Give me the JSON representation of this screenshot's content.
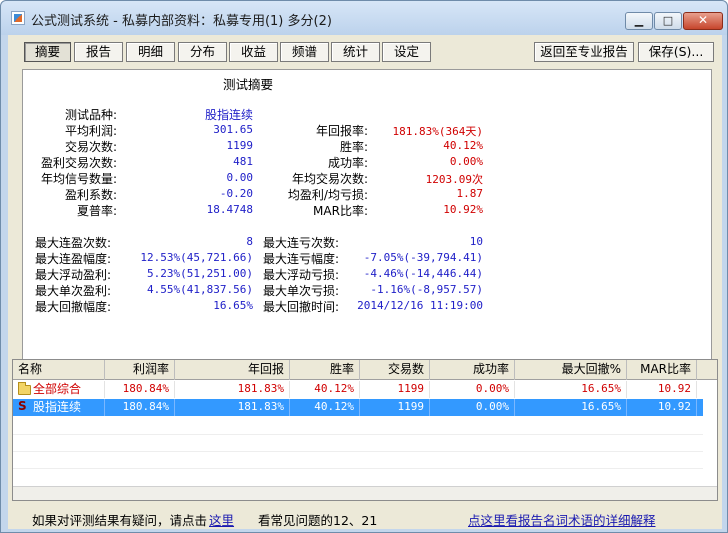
{
  "window": {
    "title": "公式测试系统 - 私募内部资料：私募专用(1) 多分(2)",
    "minimize_glyph": "▁",
    "maximize_glyph": "□",
    "close_glyph": "✕"
  },
  "tabs": [
    "摘要",
    "报告",
    "明细",
    "分布",
    "收益",
    "频谱",
    "统计",
    "设定"
  ],
  "toolbar": {
    "back_label": "返回至专业报告",
    "save_label": "保存(S)..."
  },
  "summary": {
    "title": "测试摘要",
    "left": [
      {
        "label": "测试品种:",
        "value": "股指连续"
      },
      {
        "label": "平均利润:",
        "value": "301.65"
      },
      {
        "label": "交易次数:",
        "value": "1199"
      },
      {
        "label": "盈利交易次数:",
        "value": "481"
      },
      {
        "label": "年均信号数量:",
        "value": "0.00"
      },
      {
        "label": "盈利系数:",
        "value": "-0.20"
      },
      {
        "label": "夏普率:",
        "value": "18.4748"
      }
    ],
    "right": [
      {
        "label": "年回报率:",
        "value": "181.83%(364天)"
      },
      {
        "label": "胜率:",
        "value": "40.12%"
      },
      {
        "label": "成功率:",
        "value": "0.00%"
      },
      {
        "label": "年均交易次数:",
        "value": "1203.09次"
      },
      {
        "label": "均盈利/均亏损:",
        "value": "1.87"
      },
      {
        "label": "MAR比率:",
        "value": "10.92%"
      }
    ],
    "left2": [
      {
        "label": "最大连盈次数:",
        "value": "8"
      },
      {
        "label": "最大连盈幅度:",
        "value": "12.53%(45,721.66)"
      },
      {
        "label": "最大浮动盈利:",
        "value": "5.23%(51,251.00)"
      },
      {
        "label": "最大单次盈利:",
        "value": "4.55%(41,837.56)"
      },
      {
        "label": "最大回撤幅度:",
        "value": "16.65%"
      }
    ],
    "right2": [
      {
        "label": "最大连亏次数:",
        "value": "10"
      },
      {
        "label": "最大连亏幅度:",
        "value": "-7.05%(-39,794.41)"
      },
      {
        "label": "最大浮动亏损:",
        "value": "-4.46%(-14,446.44)"
      },
      {
        "label": "最大单次亏损:",
        "value": "-1.16%(-8,957.57)"
      },
      {
        "label": "最大回撤时间:",
        "value": "2014/12/16 11:19:00"
      }
    ]
  },
  "table": {
    "headers": [
      "名称",
      "利润率",
      "年回报",
      "胜率",
      "交易数",
      "成功率",
      "最大回撤%",
      "MAR比率"
    ],
    "rows": [
      {
        "name": "全部综合",
        "icon": "folder-icon",
        "cells": [
          "180.84%",
          "181.83%",
          "40.12%",
          "1199",
          "0.00%",
          "16.65%",
          "10.92"
        ]
      },
      {
        "name": "股指连续",
        "icon": "strategy-s-icon",
        "icon_glyph": "S",
        "cells": [
          "180.84%",
          "181.83%",
          "40.12%",
          "1199",
          "0.00%",
          "16.65%",
          "10.92"
        ]
      }
    ]
  },
  "footer": {
    "question_text": "如果对评测结果有疑问，请点击",
    "here_link": "这里",
    "faq_text": "看常见问题的12、21",
    "explain_link": "点这里看报告名词术语的详细解释"
  },
  "colors": {
    "value_blue": "#2020c8",
    "value_red": "#d00000",
    "selection": "#3399ff"
  }
}
